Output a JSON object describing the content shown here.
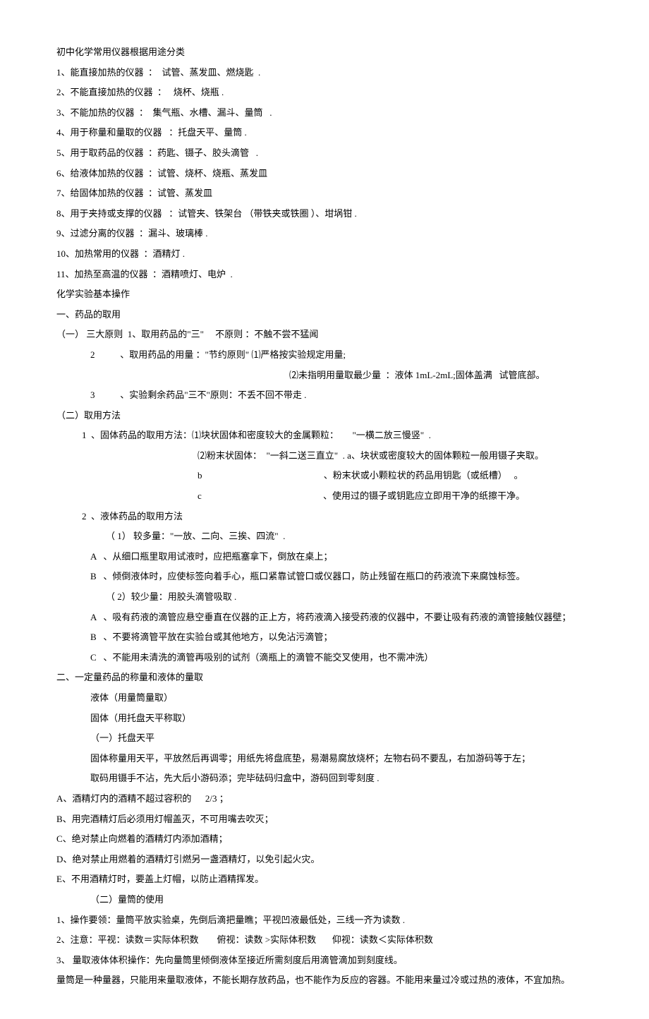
{
  "title": "初中化学常用仪器根据用途分类",
  "instruments": [
    "1、能直接加热的仪器  ：  试管、蒸发皿、燃烧匙  .",
    "2、不能直接加热的仪器  ：   烧杯、烧瓶 .",
    "3、不能加热的仪器  ：  集气瓶、水槽、漏斗、量筒   .",
    "4、用于称量和量取的仪器   ：托盘天平、量筒 .",
    "5、用于取药品的仪器  ：药匙、镊子、胶头滴管   .",
    "6、给液体加热的仪器  ：试管、烧杯、烧瓶、蒸发皿",
    "7、给固体加热的仪器  ：试管、蒸发皿",
    "8、用于夹持或支撑的仪器   ：试管夹、铁架台 （带铁夹或铁圈 ）、坩埚钳 .",
    "9、过滤分离的仪器  ：漏斗、玻璃棒 .",
    "10、加热常用的仪器  ：酒精灯 .",
    "11、加热至高温的仪器  ：酒精喷灯、电炉  ."
  ],
  "section2_title": "化学实验基本操作",
  "section_a_title": "一、药品的取用",
  "sec_a_1_label": "（一） 三大原则",
  "sec_a_1_items": [
    "1、取用药品的\"三\"     不原则 ：不触不尝不猛闻",
    "2           、取用药品的用量 ：\"节约原则\" ⑴严格按实验规定用量;",
    "⑵未指明用量取最少量  ：液体 1mL-2mL;固体盖满   试管底部。",
    "3           、实验剩余药品\"三不\"原则：不丢不回不带走 ."
  ],
  "sec_a_2_label": "（二）取用方法",
  "sec_a_2_solid": [
    "1  、固体药品的取用方法：⑴块状固体和密度较大的金属颗粒：      \"一横二放三慢竖\"  .",
    "⑵粉末状固体：  \"一斜二送三直立\"  . a、块状或密度较大的固体颗粒一般用镊子夹取。",
    "b                                                     、粉末状或小颗粒状的药品用钥匙（或纸槽）   。",
    "c                                                     、使用过的镊子或钥匙应立即用干净的纸擦干净。"
  ],
  "sec_a_2_liquid_label": "2  、液体药品的取用方法",
  "sec_a_2_liquid_more_label": "（ 1） 较多量：\"一放、二向、三挨、四流\"  .",
  "sec_a_2_liquid_more": [
    "A   、从细口瓶里取用试液时，应把瓶塞拿下，倒放在桌上；",
    "B   、倾倒液体时，应使标签向着手心，瓶口紧靠试管口或仪器口，防止残留在瓶口的药液流下来腐蚀标签。"
  ],
  "sec_a_2_liquid_less_label": "（ 2）较少量：用胶头滴管吸取 .",
  "sec_a_2_liquid_less": [
    "A   、吸有药液的滴管应悬空垂直在仪器的正上方，将药液滴入接受药液的仪器中，不要让吸有药液的滴管接触仪器壁；",
    "B   、不要将滴管平放在实验台或其他地方，以免沾污滴管；",
    "C   、不能用未清洗的滴管再吸别的试剂（滴瓶上的滴管不能交叉使用，也不需冲洗）"
  ],
  "section_b_title": "二、一定量药品的称量和液体的量取",
  "sec_b_lines": [
    "液体（用量筒量取）",
    "固体（用托盘天平称取）"
  ],
  "sec_b_1_label": "（一）托盘天平",
  "sec_b_1_lines": [
    "固体称量用天平，平放然后再调零；用纸先将盘底垫，易潮易腐放烧杯；左物右码不要乱，右加游码等于左；",
    "取码用镊手不沾，先大后小游码添；完毕砝码归盒中，游码回到零刻度 ."
  ],
  "alcohol_lamp": [
    "A、酒精灯内的酒精不超过容积的      2/3 ；",
    "B、用完酒精灯后必须用灯帽盖灭，不可用嘴去吹灭；",
    "C、绝对禁止向燃着的酒精灯内添加酒精；",
    "D、绝对禁止用燃着的酒精灯引燃另一盏酒精灯，以免引起火灾。",
    "E、不用酒精灯时，要盖上灯帽，以防止酒精挥发。"
  ],
  "sec_b_2_label": "（二）量筒的使用",
  "sec_b_2_lines": [
    "1、操作要领：量筒平放实验桌，先倒后滴把量瞧；平视凹液最低处，三线一齐为读数 .",
    "2、注意：平视：读数＝实际体积数        俯视：读数 >实际体积数       仰视：读数＜实际体积数",
    "3、 量取液体体积操作：先向量筒里倾倒液体至接近所需刻度后用滴管滴加到刻度线。"
  ],
  "sec_b_2_note": "量筒是一种量器，只能用来量取液体，不能长期存放药品，也不能作为反应的容器。不能用来量过冷或过热的液体，不宜加热。"
}
